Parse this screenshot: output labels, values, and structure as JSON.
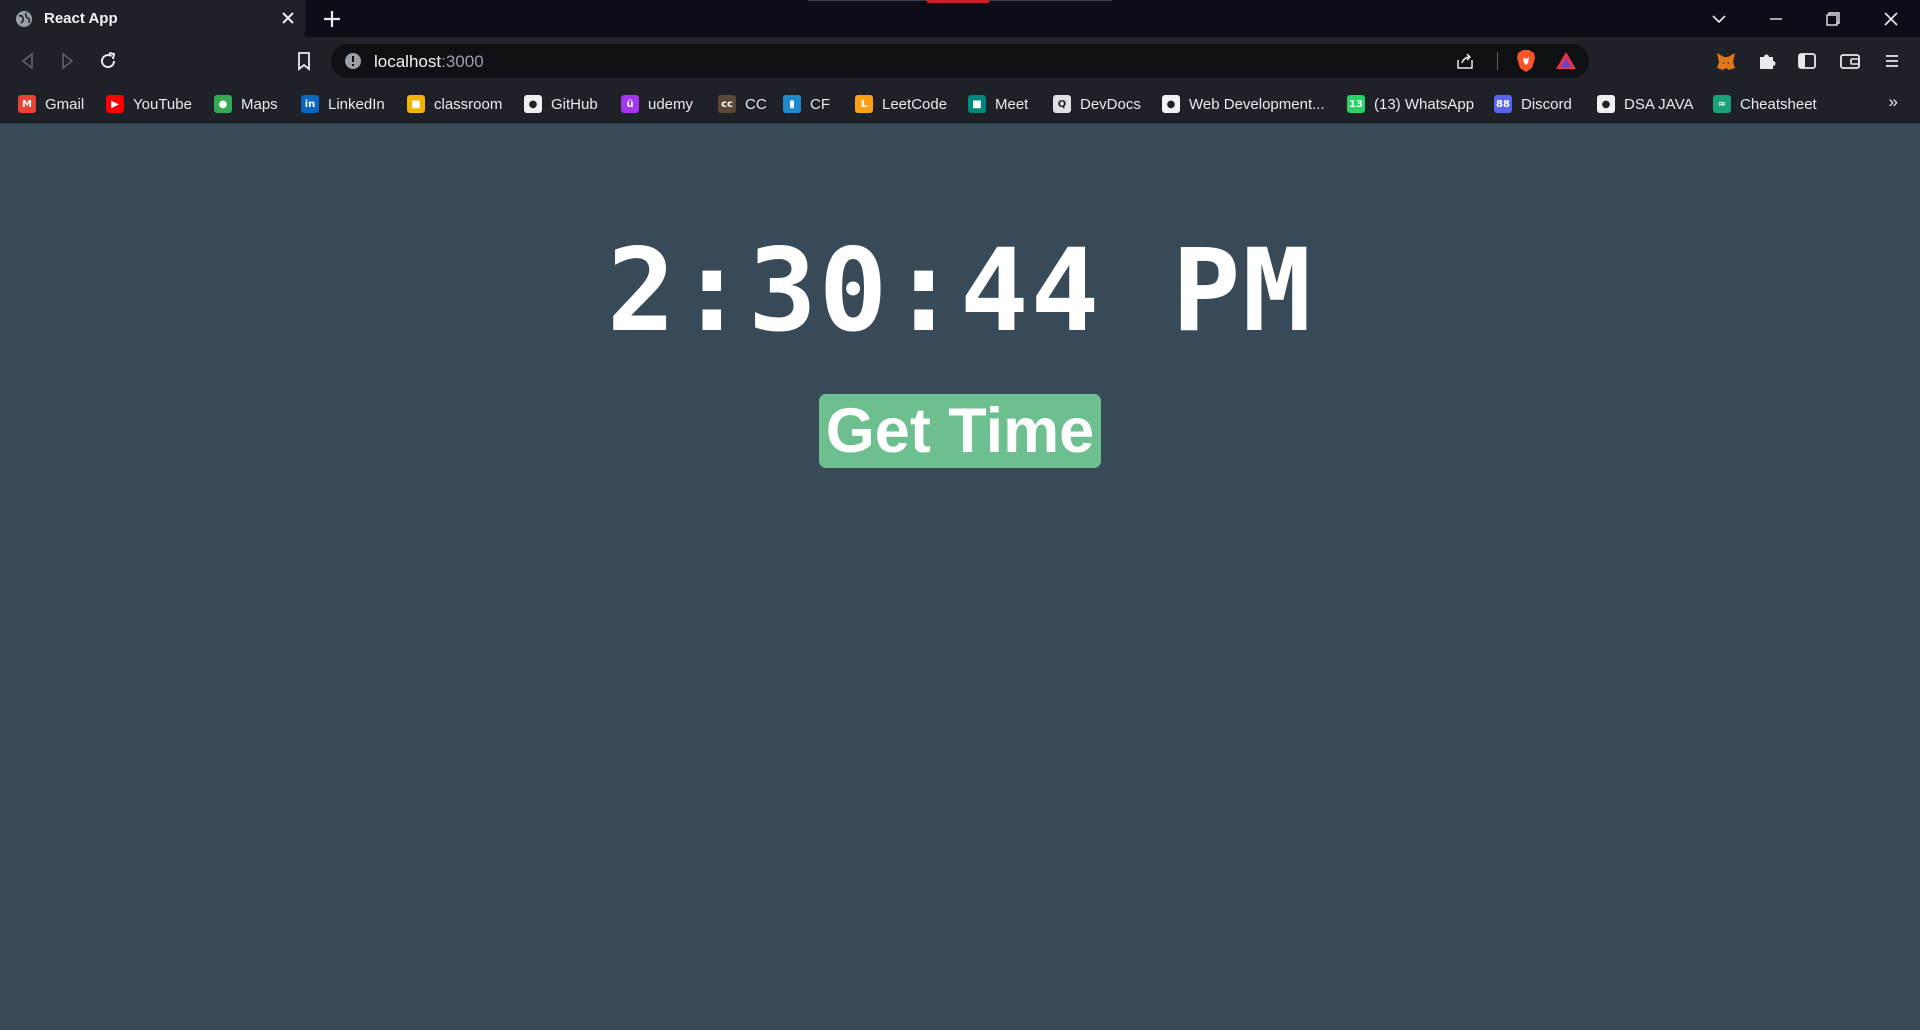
{
  "browser": {
    "tab": {
      "title": "React App"
    },
    "address_bar": {
      "host": "localhost",
      "port": ":3000"
    },
    "bookmarks": [
      {
        "label": "Gmail",
        "icon": "gmail-icon",
        "color": "#ea4335",
        "glyph": "M"
      },
      {
        "label": "YouTube",
        "icon": "youtube-icon",
        "color": "#ff0000",
        "glyph": "▶"
      },
      {
        "label": "Maps",
        "icon": "maps-icon",
        "color": "#34a853",
        "glyph": "●"
      },
      {
        "label": "LinkedIn",
        "icon": "linkedin-icon",
        "color": "#0a66c2",
        "glyph": "in"
      },
      {
        "label": "classroom",
        "icon": "classroom-icon",
        "color": "#f4b400",
        "glyph": "■"
      },
      {
        "label": "GitHub",
        "icon": "github-icon",
        "color": "#f0f0f0",
        "glyph": "●"
      },
      {
        "label": "udemy",
        "icon": "udemy-icon",
        "color": "#a435f0",
        "glyph": "ü"
      },
      {
        "label": "CC",
        "icon": "codechef-icon",
        "color": "#5b4638",
        "glyph": "cc"
      },
      {
        "label": "CF",
        "icon": "codeforces-icon",
        "color": "#1f8acb",
        "glyph": "▮"
      },
      {
        "label": "LeetCode",
        "icon": "leetcode-icon",
        "color": "#ffa116",
        "glyph": "L"
      },
      {
        "label": "Meet",
        "icon": "meet-icon",
        "color": "#00897b",
        "glyph": "■"
      },
      {
        "label": "DevDocs",
        "icon": "devdocs-icon",
        "color": "#dfe1e5",
        "glyph": "Q"
      },
      {
        "label": "Web Development...",
        "icon": "web-development-icon",
        "color": "#f1f3f4",
        "glyph": "●"
      },
      {
        "label": "(13) WhatsApp",
        "icon": "whatsapp-icon",
        "color": "#25d366",
        "glyph": "13"
      },
      {
        "label": "Discord",
        "icon": "discord-icon",
        "color": "#5865f2",
        "glyph": "88"
      },
      {
        "label": "DSA JAVA",
        "icon": "github-icon",
        "color": "#f0f0f0",
        "glyph": "●"
      },
      {
        "label": "Cheatsheet",
        "icon": "cheatsheet-icon",
        "color": "#1aa37a",
        "glyph": "≈"
      }
    ]
  },
  "page": {
    "time": "2:30:44 PM",
    "button_label": "Get Time",
    "background": "#384a57",
    "button_color": "#6dbf90"
  }
}
